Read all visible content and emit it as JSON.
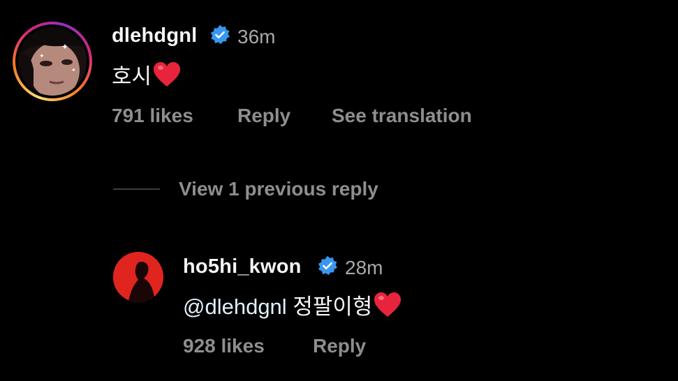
{
  "comment": {
    "username": "dlehdgnl",
    "timestamp": "36m",
    "text": "호시",
    "likes": "791 likes",
    "reply_label": "Reply",
    "translate_label": "See translation"
  },
  "replies_toggle": {
    "label": "View 1 previous reply"
  },
  "reply": {
    "username": "ho5hi_kwon",
    "timestamp": "28m",
    "mention": "@dlehdgnl",
    "text": "정팔이형",
    "likes": "928 likes",
    "reply_label": "Reply"
  },
  "colors": {
    "background": "#000000",
    "verified_badge": "#3897f0",
    "heart": "#e0245e",
    "muted_text": "#8e8e8e",
    "avatar2_bg": "#e0251f"
  }
}
